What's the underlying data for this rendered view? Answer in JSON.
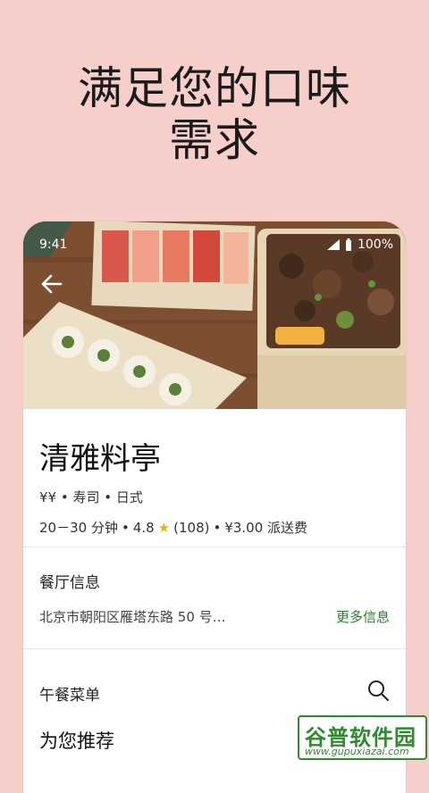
{
  "headline": {
    "line1": "满足您的口味",
    "line2": "需求"
  },
  "status": {
    "time": "9:41",
    "battery": "100%"
  },
  "restaurant": {
    "name": "清雅料亭",
    "categories": "¥¥ • 寿司 • 日式",
    "delivery_time": "20－30 分钟",
    "rating": "4.8",
    "reviews": "(108)",
    "fee": "¥3.00 派送费"
  },
  "info": {
    "header": "餐厅信息",
    "address": "北京市朝阳区雁塔东路 50 号…",
    "more_label": "更多信息"
  },
  "menu": {
    "header": "午餐菜单",
    "recommend_title": "为您推荐"
  },
  "watermark": {
    "top": "谷普软件园",
    "bottom": "www.gupuxiazai.com"
  },
  "colors": {
    "background": "#f6cfcb",
    "accent": "#2e7d32",
    "star": "#f0b400"
  }
}
